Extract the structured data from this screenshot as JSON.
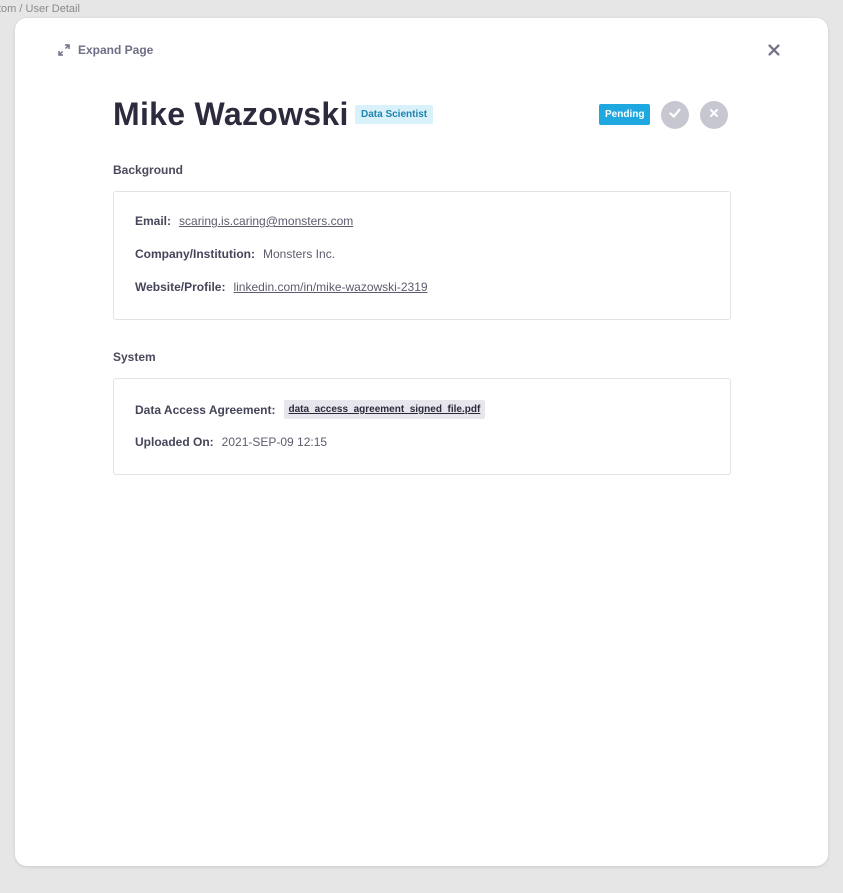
{
  "breadcrumb": "tom / User Detail",
  "modal": {
    "expand_label": "Expand Page",
    "expand_icon": "expand-icon",
    "close_icon": "close-icon"
  },
  "user": {
    "name": "Mike Wazowski",
    "role": "Data Scientist",
    "status": "Pending",
    "approve_icon": "checkmark-icon",
    "reject_icon": "x-icon"
  },
  "background": {
    "title": "Background",
    "email_label": "Email:",
    "email_value": "scaring.is.caring@monsters.com",
    "company_label": "Company/Institution:",
    "company_value": "Monsters Inc.",
    "website_label": "Website/Profile:",
    "website_value": "linkedin.com/in/mike-wazowski-2319"
  },
  "system": {
    "title": "System",
    "agreement_label": "Data Access Agreement:",
    "agreement_file": "data_access_agreement_signed_file.pdf",
    "uploaded_label": "Uploaded On:",
    "uploaded_value": "2021-SEP-09 12:15"
  },
  "colors": {
    "background": "#e6e6e6",
    "role_badge_bg": "#d9f1fb",
    "role_badge_text": "#1e84ad",
    "status_badge_bg": "#1fa8e0",
    "action_button_bg": "#c7c7d1"
  }
}
